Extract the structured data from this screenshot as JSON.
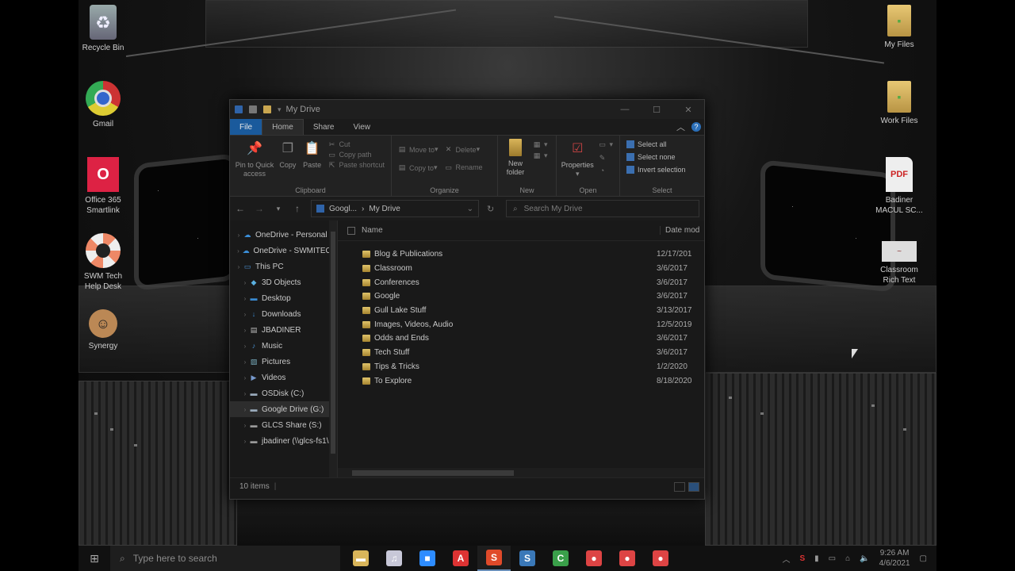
{
  "desktop": {
    "icons_left": [
      {
        "label": "Recycle Bin",
        "icon": "recycle-bin-icon"
      },
      {
        "label": "Gmail",
        "icon": "chrome-icon"
      },
      {
        "label": "Office 365\nSmartlink",
        "icon": "office-icon"
      },
      {
        "label": "SWM Tech\nHelp Desk",
        "icon": "lifebuoy-icon"
      },
      {
        "label": "Synergy",
        "icon": "synergy-icon"
      }
    ],
    "icons_right": [
      {
        "label": "My Files",
        "icon": "folder-icon"
      },
      {
        "label": "Work Files",
        "icon": "folder-icon"
      },
      {
        "label": "Badiner\nMACUL SC...",
        "icon": "pdf-icon"
      },
      {
        "label": "Classroom\nRich Text",
        "icon": "rtf-icon"
      }
    ]
  },
  "explorer": {
    "title": "My Drive",
    "tabs": [
      "File",
      "Home",
      "Share",
      "View"
    ],
    "active_tab": "Home",
    "ribbon": {
      "clipboard": {
        "group": "Clipboard",
        "pin": "Pin to Quick access",
        "copy": "Copy",
        "paste": "Paste",
        "cut": "Cut",
        "copy_path": "Copy path",
        "paste_shortcut": "Paste shortcut"
      },
      "organize": {
        "group": "Organize",
        "move_to": "Move to",
        "copy_to": "Copy to",
        "delete": "Delete",
        "rename": "Rename"
      },
      "new": {
        "group": "New",
        "new_folder": "New folder"
      },
      "open": {
        "group": "Open",
        "properties": "Properties"
      },
      "select": {
        "group": "Select",
        "select_all": "Select all",
        "select_none": "Select none",
        "invert": "Invert selection"
      }
    },
    "address": {
      "crumb1": "Googl...",
      "sep": "›",
      "crumb2": "My Drive"
    },
    "search_placeholder": "Search My Drive",
    "nav": [
      {
        "label": "OneDrive - Personal",
        "indent": 1,
        "icon": "cloud-icon"
      },
      {
        "label": "OneDrive - SWMITECH",
        "indent": 1,
        "icon": "cloud-icon"
      },
      {
        "label": "This PC",
        "indent": 1,
        "icon": "pc-icon"
      },
      {
        "label": "3D Objects",
        "indent": 2,
        "icon": "cube-icon"
      },
      {
        "label": "Desktop",
        "indent": 2,
        "icon": "desktop-icon"
      },
      {
        "label": "Downloads",
        "indent": 2,
        "icon": "download-icon"
      },
      {
        "label": "JBADINER",
        "indent": 2,
        "icon": "document-icon"
      },
      {
        "label": "Music",
        "indent": 2,
        "icon": "music-icon"
      },
      {
        "label": "Pictures",
        "indent": 2,
        "icon": "pictures-icon"
      },
      {
        "label": "Videos",
        "indent": 2,
        "icon": "videos-icon"
      },
      {
        "label": "OSDisk (C:)",
        "indent": 2,
        "icon": "disk-icon"
      },
      {
        "label": "Google Drive (G:)",
        "indent": 2,
        "icon": "drive-icon",
        "selected": true
      },
      {
        "label": "GLCS Share (S:)",
        "indent": 2,
        "icon": "network-drive-icon"
      },
      {
        "label": "jbadiner (\\\\glcs-fs1\\s",
        "indent": 2,
        "icon": "network-drive-icon"
      }
    ],
    "columns": {
      "name": "Name",
      "date": "Date mod"
    },
    "files": [
      {
        "name": "Blog & Publications",
        "date": "12/17/201"
      },
      {
        "name": "Classroom",
        "date": "3/6/2017"
      },
      {
        "name": "Conferences",
        "date": "3/6/2017"
      },
      {
        "name": "Google",
        "date": "3/6/2017"
      },
      {
        "name": "Gull Lake Stuff",
        "date": "3/13/2017"
      },
      {
        "name": "Images, Videos, Audio",
        "date": "12/5/2019"
      },
      {
        "name": "Odds and Ends",
        "date": "3/6/2017"
      },
      {
        "name": "Tech Stuff",
        "date": "3/6/2017"
      },
      {
        "name": "Tips & Tricks",
        "date": "1/2/2020"
      },
      {
        "name": "To Explore",
        "date": "8/18/2020"
      }
    ],
    "status": "10 items"
  },
  "taskbar": {
    "search_placeholder": "Type here to search",
    "apps": [
      {
        "name": "file-explorer",
        "glyph": "▬",
        "color": "#d9b55a",
        "active": false
      },
      {
        "name": "itunes",
        "glyph": "♫",
        "color": "#c8c8d8",
        "active": false
      },
      {
        "name": "zoom",
        "glyph": "■",
        "color": "#2d8cff",
        "active": false
      },
      {
        "name": "acrobat",
        "glyph": "A",
        "color": "#d33",
        "active": false
      },
      {
        "name": "screencast-red",
        "glyph": "S",
        "color": "#e04a2a",
        "active": true
      },
      {
        "name": "screencast-blue",
        "glyph": "S",
        "color": "#3a78b8",
        "active": false
      },
      {
        "name": "camtasia",
        "glyph": "C",
        "color": "#3aa04a",
        "active": false
      },
      {
        "name": "chrome-1",
        "glyph": "●",
        "color": "#d44",
        "active": false
      },
      {
        "name": "chrome-2",
        "glyph": "●",
        "color": "#d44",
        "active": false
      },
      {
        "name": "chrome-3",
        "glyph": "●",
        "color": "#d44",
        "active": false
      }
    ],
    "time": "9:26 AM",
    "date": "4/6/2021"
  }
}
